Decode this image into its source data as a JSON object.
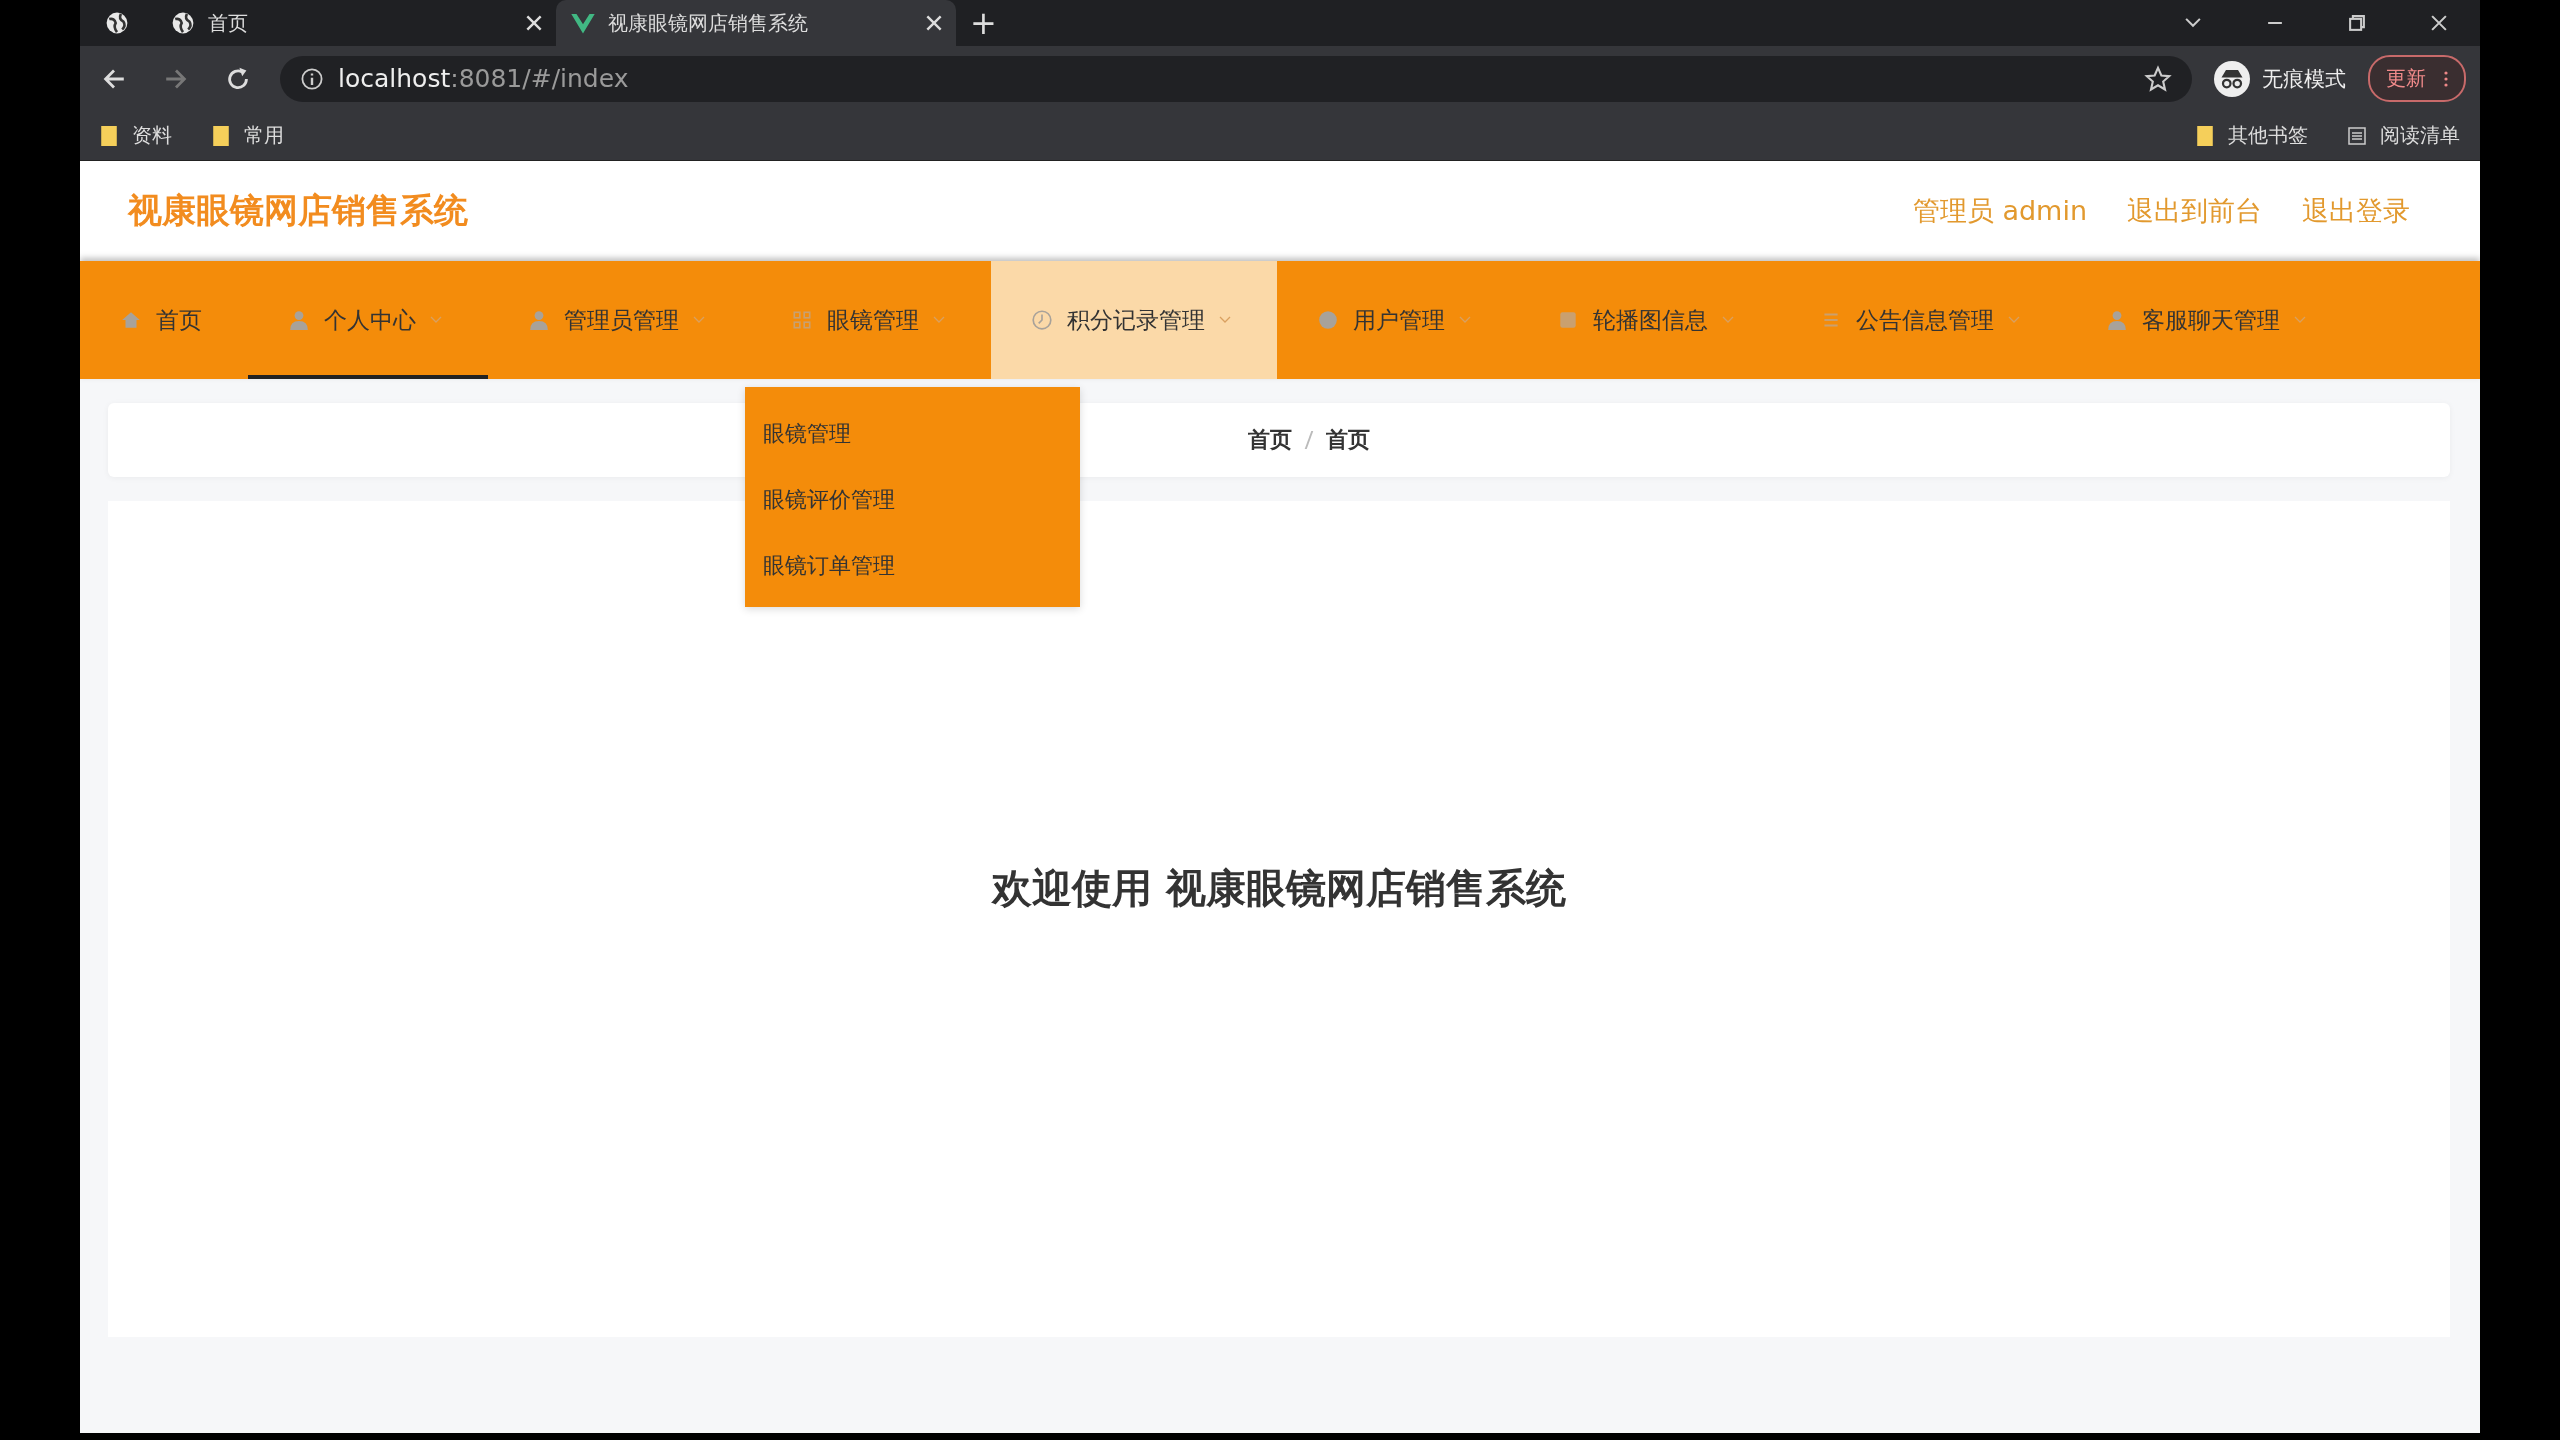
{
  "browser": {
    "tabs": [
      {
        "title": "首页",
        "selected": false
      },
      {
        "title": "视康眼镜网店销售系统",
        "selected": true
      }
    ],
    "new_tab": "+",
    "address": {
      "host": "localhost",
      "rest": ":8081/#/index"
    },
    "profile": "无痕模式",
    "update_button": "更新",
    "bookmarks": [
      "资料",
      "常用"
    ],
    "bookmarks_right": [
      "其他书签",
      "阅读清单"
    ]
  },
  "header": {
    "title": "视康眼镜网店销售系统",
    "user": "管理员 admin",
    "links": [
      "退出到前台",
      "退出登录"
    ]
  },
  "nav": [
    {
      "label": "首页",
      "selected": false,
      "hovered": false,
      "has_menu": false
    },
    {
      "label": "个人中心",
      "selected": true,
      "hovered": false,
      "has_menu": true
    },
    {
      "label": "管理员管理",
      "selected": false,
      "hovered": false,
      "has_menu": true
    },
    {
      "label": "眼镜管理",
      "selected": false,
      "hovered": false,
      "has_menu": true,
      "expanded": true,
      "children": [
        "眼镜管理",
        "眼镜评价管理",
        "眼镜订单管理"
      ]
    },
    {
      "label": "积分记录管理",
      "selected": false,
      "hovered": true,
      "has_menu": true
    },
    {
      "label": "用户管理",
      "selected": false,
      "hovered": false,
      "has_menu": true
    },
    {
      "label": "轮播图信息",
      "selected": false,
      "hovered": false,
      "has_menu": true
    },
    {
      "label": "公告信息管理",
      "selected": false,
      "hovered": false,
      "has_menu": true
    },
    {
      "label": "客服聊天管理",
      "selected": false,
      "hovered": false,
      "has_menu": true
    }
  ],
  "breadcrumb": [
    "首页",
    "首页"
  ],
  "welcome": "欢迎使用 视康眼镜网店销售系统"
}
